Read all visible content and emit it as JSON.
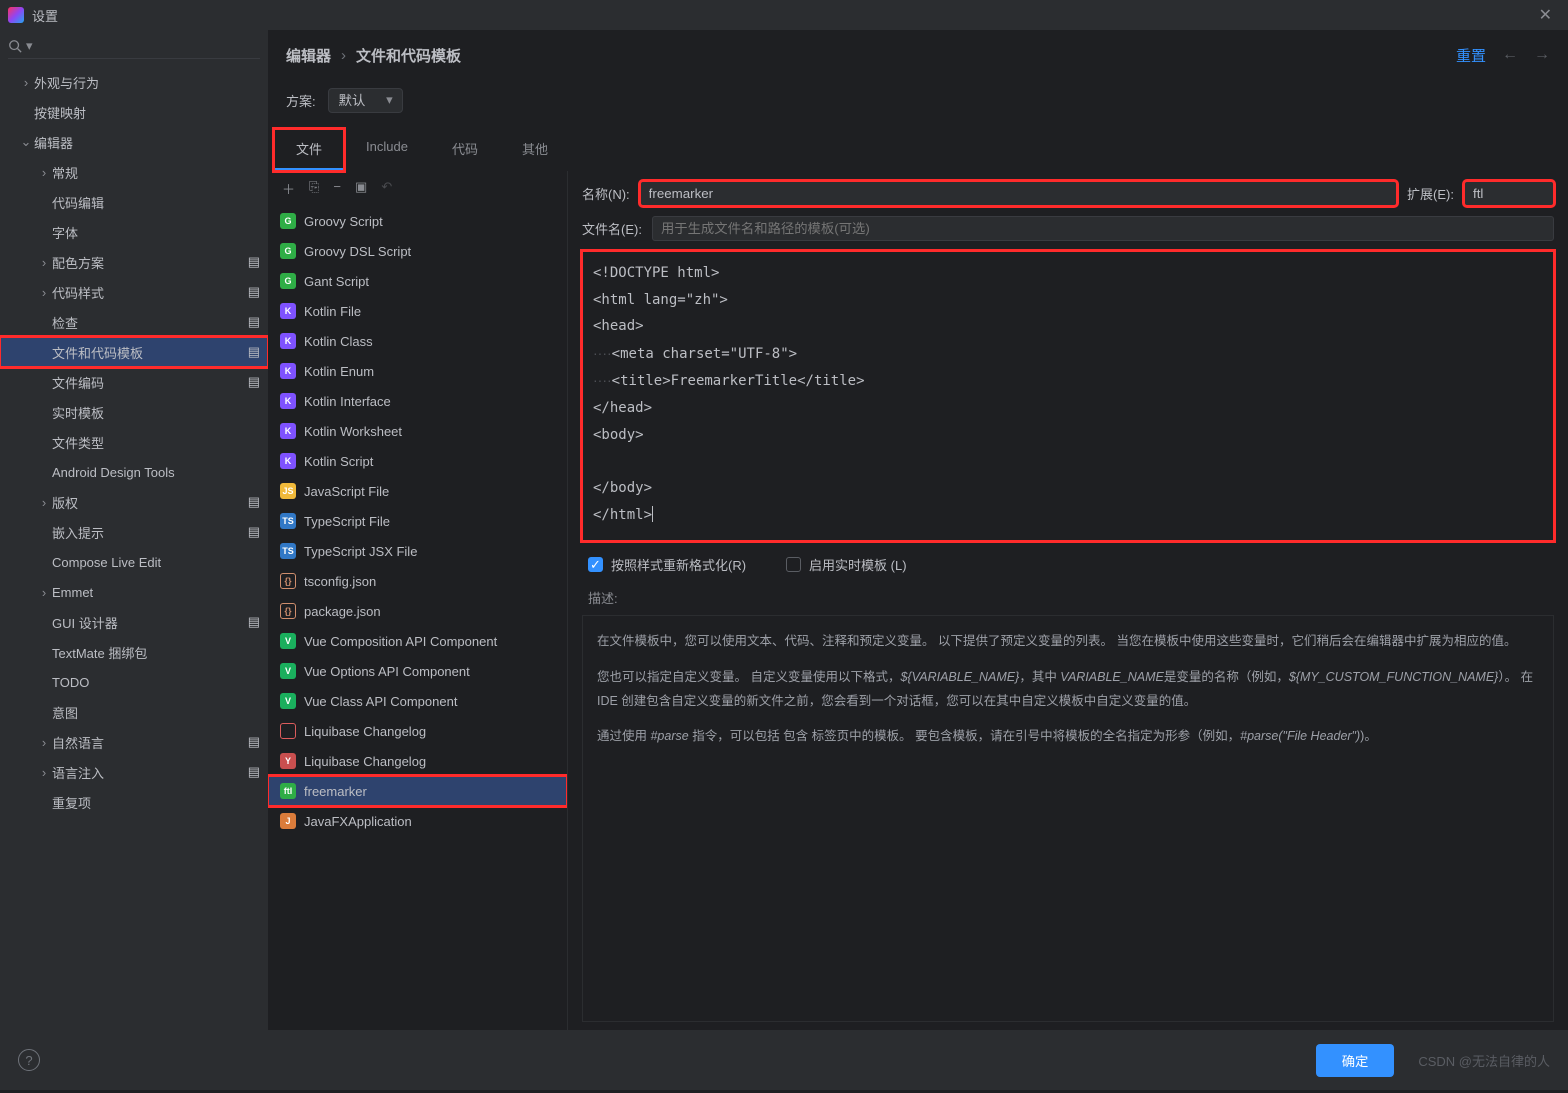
{
  "window": {
    "title": "设置"
  },
  "left_tree": [
    {
      "indent": 1,
      "chev": "›",
      "label": "外观与行为"
    },
    {
      "indent": 1,
      "chev": "",
      "label": "按键映射"
    },
    {
      "indent": 1,
      "chev": "⌄",
      "label": "编辑器"
    },
    {
      "indent": 2,
      "chev": "›",
      "label": "常规"
    },
    {
      "indent": 2,
      "chev": "",
      "label": "代码编辑"
    },
    {
      "indent": 2,
      "chev": "",
      "label": "字体"
    },
    {
      "indent": 2,
      "chev": "›",
      "label": "配色方案",
      "gear": true
    },
    {
      "indent": 2,
      "chev": "›",
      "label": "代码样式",
      "gear": true
    },
    {
      "indent": 2,
      "chev": "",
      "label": "检查",
      "gear": true
    },
    {
      "indent": 2,
      "chev": "",
      "label": "文件和代码模板",
      "gear": true,
      "sel": true,
      "hl": true
    },
    {
      "indent": 2,
      "chev": "",
      "label": "文件编码",
      "gear": true
    },
    {
      "indent": 2,
      "chev": "",
      "label": "实时模板"
    },
    {
      "indent": 2,
      "chev": "",
      "label": "文件类型"
    },
    {
      "indent": 2,
      "chev": "",
      "label": "Android Design Tools"
    },
    {
      "indent": 2,
      "chev": "›",
      "label": "版权",
      "gear": true
    },
    {
      "indent": 2,
      "chev": "",
      "label": "嵌入提示",
      "gear": true
    },
    {
      "indent": 2,
      "chev": "",
      "label": "Compose Live Edit"
    },
    {
      "indent": 2,
      "chev": "›",
      "label": "Emmet"
    },
    {
      "indent": 2,
      "chev": "",
      "label": "GUI 设计器",
      "gear": true
    },
    {
      "indent": 2,
      "chev": "",
      "label": "TextMate 捆绑包"
    },
    {
      "indent": 2,
      "chev": "",
      "label": "TODO"
    },
    {
      "indent": 2,
      "chev": "",
      "label": "意图"
    },
    {
      "indent": 2,
      "chev": "›",
      "label": "自然语言",
      "gear": true
    },
    {
      "indent": 2,
      "chev": "›",
      "label": "语言注入",
      "gear": true
    },
    {
      "indent": 2,
      "chev": "",
      "label": "重复项"
    }
  ],
  "crumbs": {
    "a": "编辑器",
    "b": "文件和代码模板",
    "reset": "重置"
  },
  "scheme": {
    "label": "方案:",
    "value": "默认"
  },
  "tabs": [
    "文件",
    "Include",
    "代码",
    "其他"
  ],
  "template_items": [
    {
      "ic": "G",
      "bg": "#2fad46",
      "label": "Groovy Script"
    },
    {
      "ic": "G",
      "bg": "#2fad46",
      "label": "Groovy DSL Script"
    },
    {
      "ic": "G",
      "bg": "#2fad46",
      "label": "Gant Script"
    },
    {
      "ic": "K",
      "bg": "#7f52ff",
      "label": "Kotlin File"
    },
    {
      "ic": "K",
      "bg": "#7f52ff",
      "label": "Kotlin Class"
    },
    {
      "ic": "K",
      "bg": "#7f52ff",
      "label": "Kotlin Enum"
    },
    {
      "ic": "K",
      "bg": "#7f52ff",
      "label": "Kotlin Interface"
    },
    {
      "ic": "K",
      "bg": "#7f52ff",
      "label": "Kotlin Worksheet"
    },
    {
      "ic": "K",
      "bg": "#7f52ff",
      "label": "Kotlin Script"
    },
    {
      "ic": "JS",
      "bg": "#f0b93a",
      "label": "JavaScript File"
    },
    {
      "ic": "TS",
      "bg": "#3178c6",
      "label": "TypeScript File"
    },
    {
      "ic": "TS",
      "bg": "#3178c6",
      "label": "TypeScript JSX File"
    },
    {
      "ic": "{}",
      "bg": "transparent",
      "label": "tsconfig.json",
      "fg": "#cf8e6d"
    },
    {
      "ic": "{}",
      "bg": "transparent",
      "label": "package.json",
      "fg": "#cf8e6d"
    },
    {
      "ic": "V",
      "bg": "#1aaf5d",
      "label": "Vue Composition API Component"
    },
    {
      "ic": "V",
      "bg": "#1aaf5d",
      "label": "Vue Options API Component"
    },
    {
      "ic": "V",
      "bg": "#1aaf5d",
      "label": "Vue Class API Component"
    },
    {
      "ic": "</>",
      "bg": "transparent",
      "label": "Liquibase Changelog",
      "fg": "#db5c5c"
    },
    {
      "ic": "Y",
      "bg": "#c94f4f",
      "label": "Liquibase Changelog"
    },
    {
      "ic": "ftl",
      "bg": "#2fad46",
      "label": "freemarker",
      "sel": true,
      "hl": true
    },
    {
      "ic": "J",
      "bg": "#db7c3b",
      "label": "JavaFXApplication"
    }
  ],
  "fields": {
    "name_label": "名称(N):",
    "name_value": "freemarker",
    "ext_label": "扩展(E):",
    "ext_value": "ftl",
    "file_label": "文件名(E):",
    "file_placeholder": "用于生成文件名和路径的模板(可选)"
  },
  "code_lines": [
    "<!DOCTYPE html>",
    "<html lang=\"zh\">",
    "<head>",
    "····<meta charset=\"UTF-8\">",
    "····<title>FreemarkerTitle</title>",
    "</head>",
    "<body>",
    "",
    "</body>",
    "</html>"
  ],
  "options": {
    "reformat": "按照样式重新格式化(R)",
    "live": "启用实时模板  (L)"
  },
  "desc_title": "描述:",
  "desc_body": [
    "在文件模板中，您可以使用文本、代码、注释和预定义变量。  以下提供了预定义变量的列表。  当您在模板中使用这些变量时，它们稍后会在编辑器中扩展为相应的值。",
    "您也可以指定自定义变量。  自定义变量使用以下格式，<i>${VARIABLE_NAME}</i>，其中 <i>VARIABLE_NAME</i>是变量的名称（例如，<i>${MY_CUSTOM_FUNCTION_NAME}</i>）。  在 IDE 创建包含自定义变量的新文件之前，您会看到一个对话框，您可以在其中自定义模板中自定义变量的值。",
    "通过使用 <i>#parse</i> 指令，可以包括 包含 标签页中的模板。  要包含模板，请在引号中将模板的全名指定为形参（例如，<i>#parse(\"File Header\")</i>)。"
  ],
  "footer": {
    "ok": "确定",
    "watermark": "CSDN @无法自律的人"
  }
}
